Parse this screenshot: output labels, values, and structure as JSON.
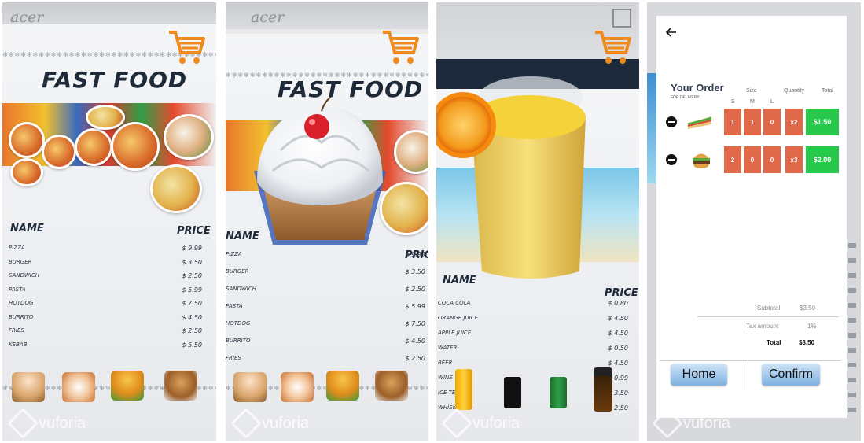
{
  "panels": {
    "p1": {
      "brand": "acer",
      "title": "FAST FOOD",
      "name_header": "NAME",
      "price_header": "PRICE",
      "items": [
        {
          "name": "PIZZA",
          "price": "$ 9.99"
        },
        {
          "name": "BURGER",
          "price": "$ 3.50"
        },
        {
          "name": "SANDWICH",
          "price": "$ 2.50"
        },
        {
          "name": "PASTA",
          "price": "$ 5.99"
        },
        {
          "name": "HOTDOG",
          "price": "$ 7.50"
        },
        {
          "name": "BURRITO",
          "price": "$ 4.50"
        },
        {
          "name": "FRIES",
          "price": "$ 2.50"
        },
        {
          "name": "KEBAB",
          "price": "$ 5.50"
        }
      ],
      "watermark": "vuforia"
    },
    "p2": {
      "brand": "acer",
      "title": "FAST FOOD",
      "name_header": "NAME",
      "price_header": "PRICE",
      "items": [
        {
          "name": "PIZZA",
          "price": "$ 9.99"
        },
        {
          "name": "BURGER",
          "price": "$ 3.50"
        },
        {
          "name": "SANDWICH",
          "price": "$ 2.50"
        },
        {
          "name": "PASTA",
          "price": "$ 5.99"
        },
        {
          "name": "HOTDOG",
          "price": "$ 7.50"
        },
        {
          "name": "BURRITO",
          "price": "$ 4.50"
        },
        {
          "name": "FRIES",
          "price": "$ 2.50"
        }
      ],
      "watermark": "vuforia"
    },
    "p3": {
      "name_header": "NAME",
      "price_header": "PRICE",
      "items": [
        {
          "name": "COCA COLA",
          "price": "$ 0.80"
        },
        {
          "name": "ORANGE JUICE",
          "price": "$ 4.50"
        },
        {
          "name": "APPLE JUICE",
          "price": "$ 4.50"
        },
        {
          "name": "WATER",
          "price": "$ 0.50"
        },
        {
          "name": "BEER",
          "price": "$ 4.50"
        },
        {
          "name": "WINE",
          "price": "$ 0.99"
        },
        {
          "name": "ICE TEA",
          "price": "$ 3.50"
        },
        {
          "name": "WHISKEY",
          "price": "$ 2.50"
        }
      ],
      "watermark": "vuforia"
    },
    "p4": {
      "back_icon": "arrow-left-icon",
      "title": "Your Order",
      "subtitle": "FOR DELIVERY",
      "col_size": "Size",
      "col_quantity": "Quantity",
      "col_total": "Total",
      "sizes": [
        "S",
        "M",
        "L"
      ],
      "rows": [
        {
          "item": "sandwich",
          "s": "1",
          "m": "1",
          "l": "0",
          "qty": "x2",
          "total": "$1.50"
        },
        {
          "item": "burger",
          "s": "2",
          "m": "0",
          "l": "0",
          "qty": "x3",
          "total": "$2.00"
        }
      ],
      "subtotal_label": "Subtotal",
      "subtotal_value": "$3.50",
      "tax_label": "Tax amount",
      "tax_value": "1%",
      "total_label": "Total",
      "total_value": "$3.50",
      "home_label": "Home",
      "confirm_label": "Confirm",
      "watermark": "vuforia"
    }
  },
  "colors": {
    "cart": "#f08a1c",
    "qty_box": "#e0694a",
    "total_box": "#26c94a"
  }
}
